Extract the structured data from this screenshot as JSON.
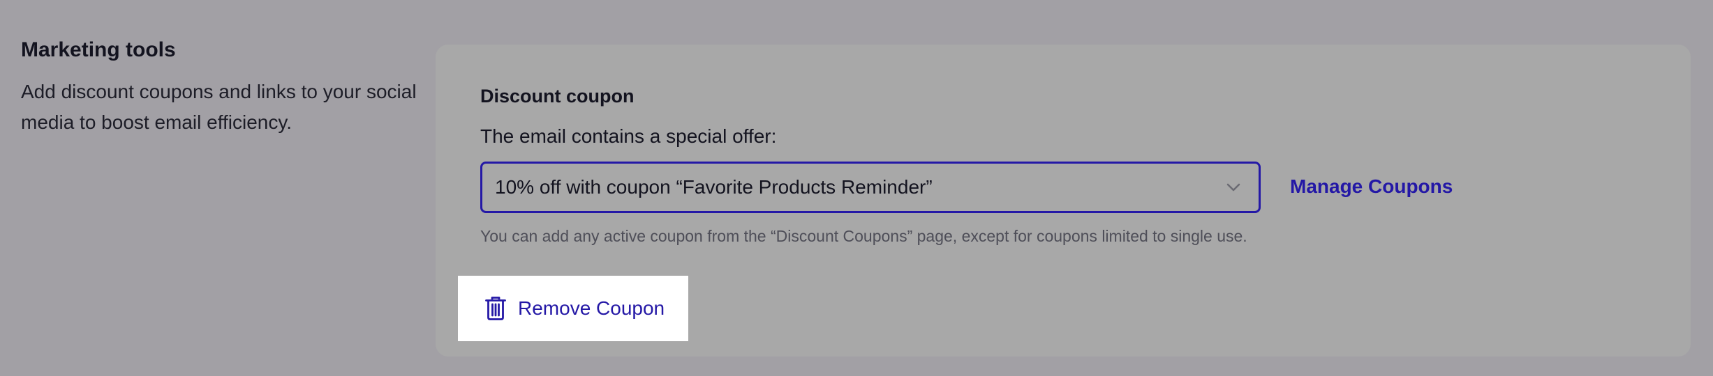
{
  "marketing": {
    "title": "Marketing tools",
    "description_line1": "Add discount coupons and links to your social",
    "description_line2": "media to boost email efficiency."
  },
  "coupon": {
    "title": "Discount coupon",
    "offer_label": "The email contains a special offer:",
    "selected": "10% off with coupon “Favorite Products Reminder”",
    "manage_link": "Manage Coupons",
    "hint": "You can add any active coupon from the “Discount Coupons” page, except for coupons limited to single use.",
    "remove_label": "Remove Coupon"
  },
  "icons": {
    "dropdown": "chevron-down-icon",
    "remove": "trash-icon"
  },
  "colors": {
    "accent": "#2418a6",
    "overlay_background": "#a2a0a5",
    "card_background": "#a8a8a8"
  }
}
